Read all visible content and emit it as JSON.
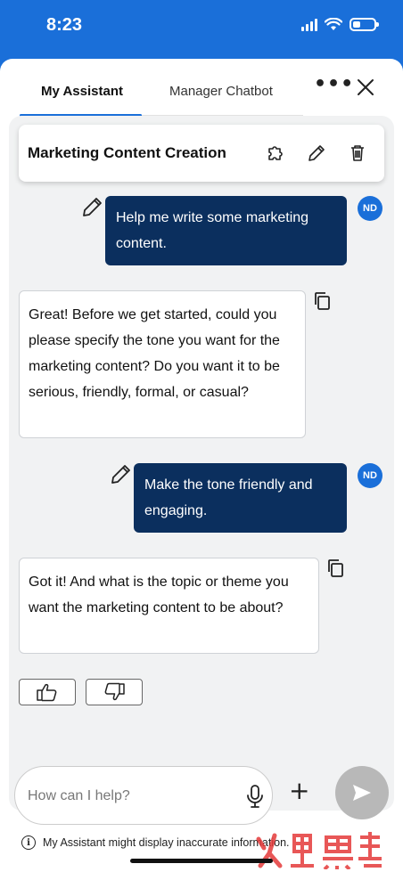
{
  "status_bar": {
    "time": "8:23"
  },
  "tabs": [
    {
      "label": "My Assistant",
      "active": true
    },
    {
      "label": "Manager Chatbot",
      "active": false
    }
  ],
  "header": {
    "more_label": "•••"
  },
  "conversation": {
    "title": "Marketing Content Creation"
  },
  "messages": [
    {
      "role": "user",
      "avatar": "ND",
      "text": "Help me write some marketing content."
    },
    {
      "role": "assistant",
      "text": "Great! Before we get started, could you please specify the tone you want for the marketing content? Do you want it to be serious, friendly, formal, or casual?"
    },
    {
      "role": "user",
      "avatar": "ND",
      "text": "Make the tone friendly and engaging."
    },
    {
      "role": "assistant",
      "text": "Got it! And what is the topic or theme you want the marketing content to be about?"
    }
  ],
  "composer": {
    "placeholder": "How can I help?"
  },
  "disclaimer": "My Assistant might display inaccurate information.",
  "colors": {
    "brand_blue": "#1a6fd9",
    "user_bubble": "#0b2f5e",
    "chat_bg": "#f1f2f3",
    "send_disabled": "#b8b8b8"
  },
  "icons": [
    "puzzle-icon",
    "pencil-icon",
    "trash-icon",
    "edit-icon",
    "copy-icon",
    "thumbs-up-icon",
    "thumbs-down-icon",
    "mic-icon",
    "plus-icon",
    "send-icon",
    "close-icon",
    "info-icon"
  ]
}
